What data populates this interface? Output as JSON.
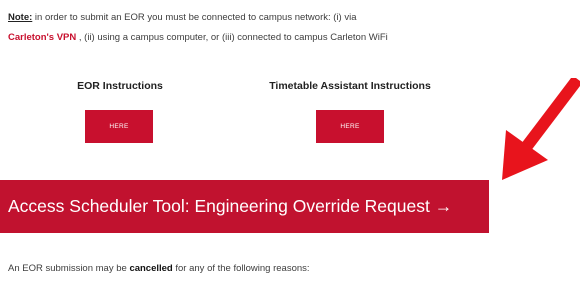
{
  "note": {
    "label": "Note:",
    "text_before_link": " in order to submit an EOR you must be connected to campus network: (i) via",
    "vpn_link": "Carleton's VPN",
    "text_after_link": " , (ii) using a campus computer, or (iii) connected to campus Carleton WiFi"
  },
  "instructions": [
    {
      "title": "EOR Instructions",
      "button_label": "HERE"
    },
    {
      "title": "Timetable Assistant Instructions",
      "button_label": "HERE"
    }
  ],
  "scheduler_button": {
    "label": "Access Scheduler Tool: Engineering Override Request →"
  },
  "cancellation": {
    "text_before": "An EOR submission may be ",
    "bold": "cancelled",
    "text_after": " for any of the following reasons:"
  },
  "colors": {
    "accent": "#c8102e",
    "arrow": "#e8141c"
  },
  "icons": {
    "annotation_arrow": "red-arrow-icon"
  }
}
